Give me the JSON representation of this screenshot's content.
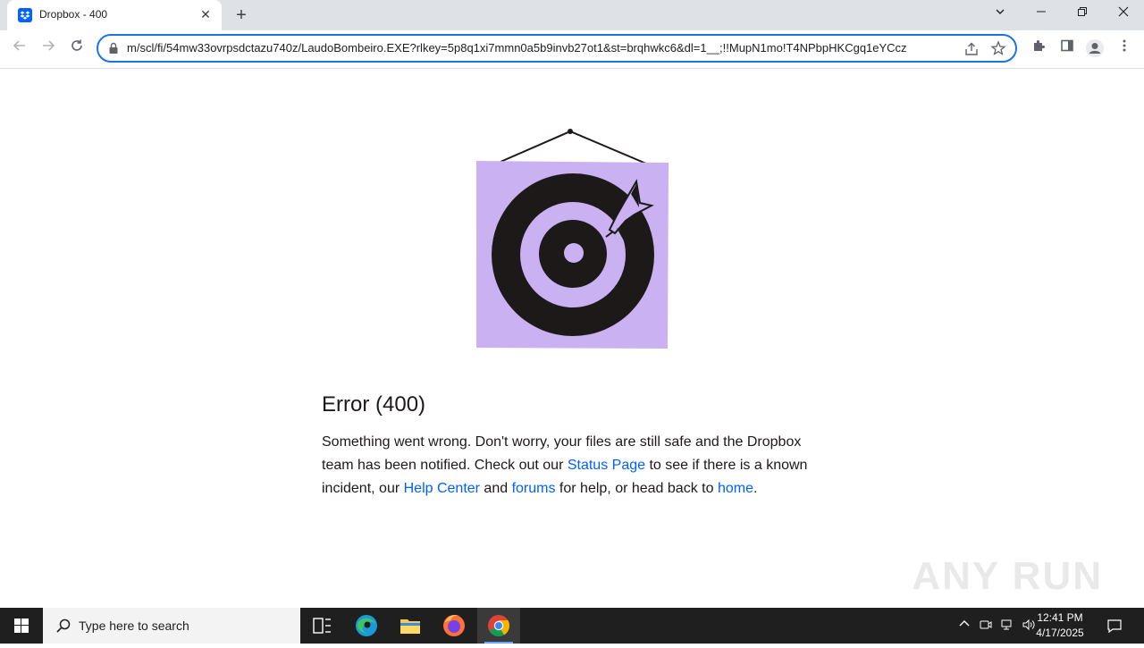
{
  "browser": {
    "tab_title": "Dropbox - 400",
    "tab_close": "✕",
    "new_tab": "+",
    "url": "m/scl/fi/54mw33ovrpsdctazu740z/LaudoBombeiro.EXE?rlkey=5p8q1xi7mmn0a5b9invb27ot1&st=brqhwkc6&dl=1__;!!MupN1mo!T4NPbpHKCgq1eYCcz"
  },
  "page": {
    "heading": "Error (400)",
    "text_1": "Something went wrong. Don't worry, your files are still safe and the Dropbox team has been notified. Check out our ",
    "link_status": "Status Page",
    "text_2": " to see if there is a known incident, our ",
    "link_help": "Help Center",
    "text_3": " and ",
    "link_forums": "forums",
    "text_4": " for help, or head back to ",
    "link_home": "home",
    "text_5": ".",
    "illustration_color": "#c9b1f2",
    "link_color": "#0061fe"
  },
  "watermark": "ANY RUN",
  "taskbar": {
    "search_placeholder": "Type here to search",
    "time": "12:41 PM",
    "date": "4/17/2025"
  }
}
